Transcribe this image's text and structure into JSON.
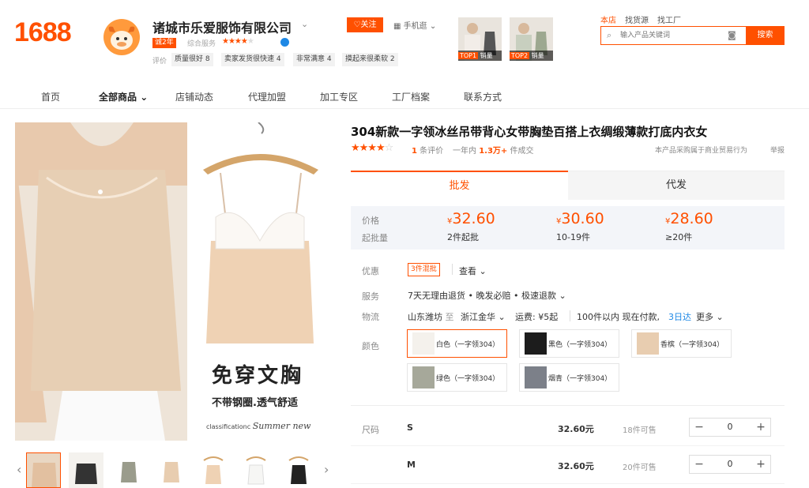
{
  "header": {
    "logo": "1688",
    "shop_name": "诸城市乐爱服饰有限公司",
    "years_badge": "诚2年",
    "service_label": "综合服务",
    "tags_label": "评价",
    "tags": [
      "质量很好 8",
      "卖家发货很快速 4",
      "非常满意 4",
      "摸起来很柔软 2"
    ],
    "follow_label": "关注",
    "phone_label": "手机逛",
    "top_items": [
      {
        "rank": "TOP1",
        "label": "销量"
      },
      {
        "rank": "TOP2",
        "label": "销量"
      }
    ],
    "search_tabs": [
      "本店",
      "找货源",
      "找工厂"
    ],
    "search_placeholder": "输入产品关键词",
    "search_button": "搜索"
  },
  "nav": {
    "items": [
      "首页",
      "全部商品",
      "店铺动态",
      "代理加盟",
      "加工专区",
      "工厂档案",
      "联系方式"
    ],
    "active_index": 1
  },
  "gallery": {
    "big_text": "免穿文胸",
    "mid_text": "不带钢圈.透气舒适",
    "small_text": "classificationc",
    "script_text": "Summer new",
    "thumbnail_count": 9
  },
  "product": {
    "title": "304新款一字领冰丝吊带背心女带胸垫百搭上衣绸缎薄款打底内衣女",
    "rating": 4,
    "review_count": "1",
    "review_suffix": "条评价",
    "annual_prefix": "一年内",
    "annual_count": "1.3万+",
    "annual_suffix": "件成交",
    "trade_note": "本产品采购属于商业贸易行为",
    "report": "举报"
  },
  "tabs": {
    "wholesale": "批发",
    "dropship": "代发"
  },
  "pricing": {
    "price_label": "价格",
    "qty_label": "起批量",
    "currency": "¥",
    "tiers": [
      {
        "price": "32.60",
        "qty": "2件起批"
      },
      {
        "price": "30.60",
        "qty": "10-19件"
      },
      {
        "price": "28.60",
        "qty": "≥20件"
      }
    ]
  },
  "promo": {
    "label": "优惠",
    "tag": "3件混批",
    "view": "查看"
  },
  "service": {
    "label": "服务",
    "text": "7天无理由退货 • 晚发必赔 • 极速退款"
  },
  "logistics": {
    "label": "物流",
    "from": "山东潍坊",
    "to_word": "至",
    "to": "浙江金华",
    "fee": "运费: ¥5起",
    "within": "100件以内  现在付款,",
    "arrival": "3日达",
    "more": "更多"
  },
  "colors": {
    "label": "颜色",
    "options": [
      {
        "name": "白色（一字领304）",
        "swatch": "#f4f1ec"
      },
      {
        "name": "黑色（一字领304）",
        "swatch": "#1c1c1c"
      },
      {
        "name": "香槟（一字领304）",
        "swatch": "#e8cdb0"
      },
      {
        "name": "绿色（一字领304）",
        "swatch": "#a6a89a"
      },
      {
        "name": "烟青（一字领304）",
        "swatch": "#7c8089"
      }
    ],
    "selected_index": 0
  },
  "sizes": {
    "label": "尺码",
    "rows": [
      {
        "size": "S",
        "price": "32.60元",
        "stock": "18件可售",
        "qty": "0"
      },
      {
        "size": "M",
        "price": "32.60元",
        "stock": "20件可售",
        "qty": "0"
      }
    ]
  },
  "colors_theme": {
    "accent": "#ff5000",
    "link": "#1e88e5"
  }
}
